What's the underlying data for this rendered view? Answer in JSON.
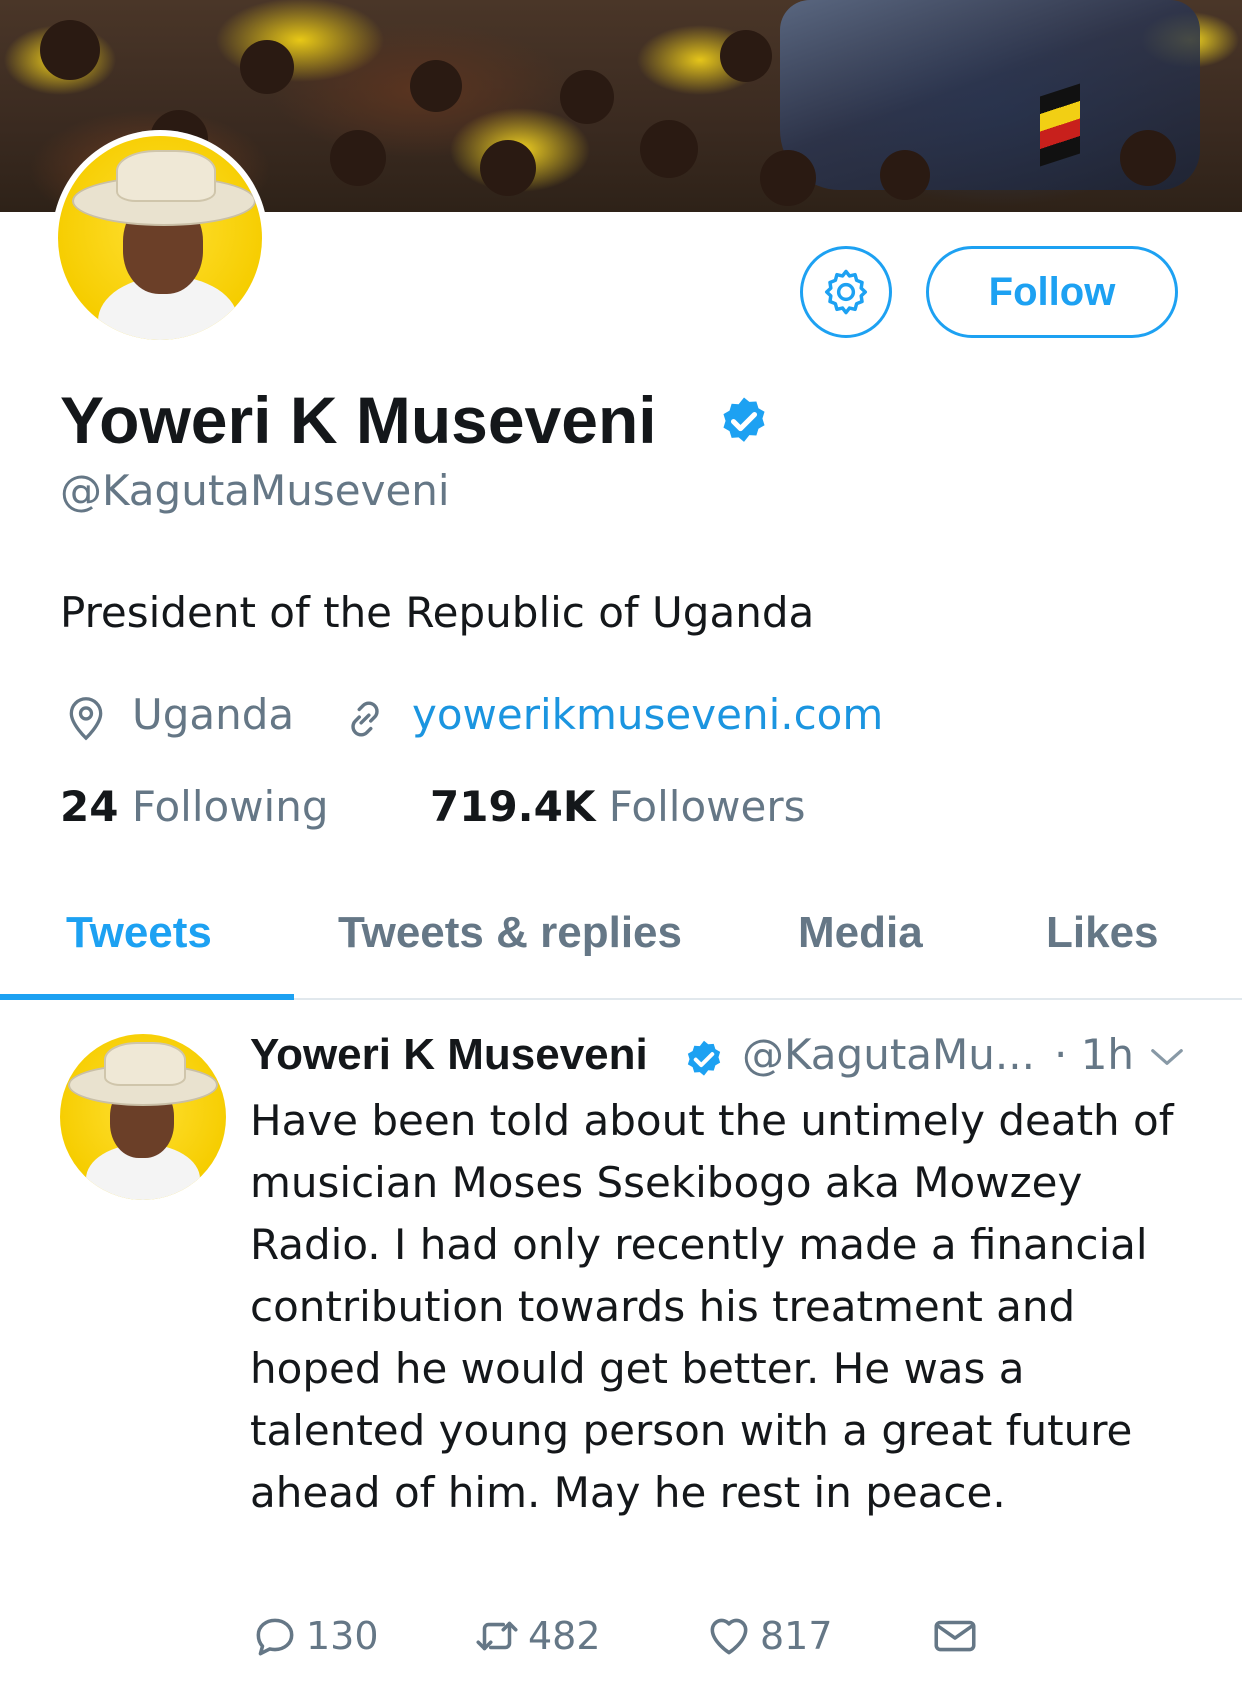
{
  "profile": {
    "name": "Yoweri K Museveni",
    "handle": "@KagutaMuseveni",
    "bio": "President of the Republic of Uganda",
    "location": "Uganda",
    "website": "yowerikmuseveni.com",
    "following_count": "24",
    "following_label": "Following",
    "followers_count": "719.4K",
    "followers_label": "Followers",
    "follow_label": "Follow",
    "verified": true
  },
  "tabs": [
    {
      "label": "Tweets",
      "active": true
    },
    {
      "label": "Tweets & replies",
      "active": false
    },
    {
      "label": "Media",
      "active": false
    },
    {
      "label": "Likes",
      "active": false
    }
  ],
  "tweet": {
    "name": "Yoweri K Museveni",
    "handle": "@KagutaMu...",
    "time": "· 1h",
    "text": "Have been told about the untimely death of musician Moses Ssekibogo aka Mowzey Radio. I had only recently made a financial contribution towards his treatment and hoped he would get better. He was a talented young person with a great future ahead of him. May he rest in peace.",
    "replies": "130",
    "retweets": "482",
    "likes": "817"
  },
  "icons": {
    "settings": "gear-icon",
    "verified": "verified-badge-icon",
    "location": "location-pin-icon",
    "link": "link-icon",
    "reply": "reply-icon",
    "retweet": "retweet-icon",
    "like": "heart-icon",
    "dm": "envelope-icon",
    "menu": "chevron-down-icon"
  },
  "colors": {
    "accent": "#1da1f2",
    "link": "#1b95e0",
    "secondary_text": "#657786",
    "primary_text": "#14171a",
    "avatar_bg": "#f6cd00"
  }
}
